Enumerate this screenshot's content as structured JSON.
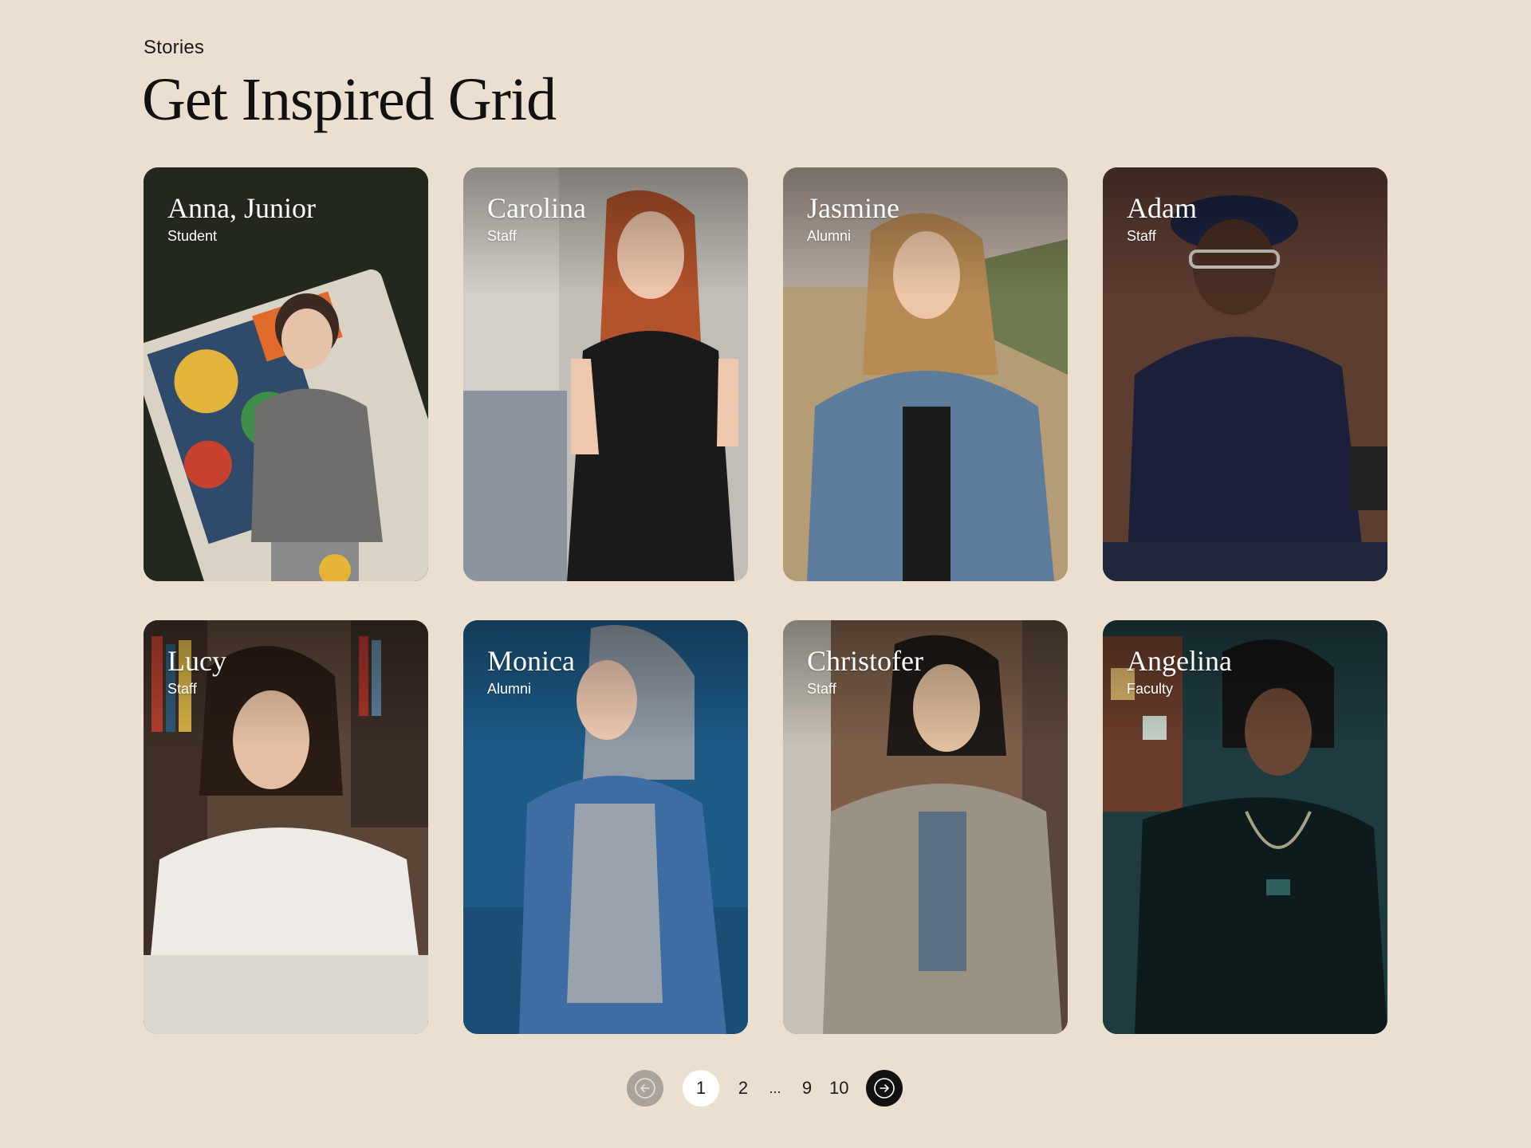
{
  "header": {
    "eyebrow": "Stories",
    "title": "Get Inspired Grid"
  },
  "cards": [
    {
      "name": "Anna, Junior",
      "role": "Student",
      "bg": "#22281e"
    },
    {
      "name": "Carolina",
      "role": "Staff",
      "bg": "#b9b3ac"
    },
    {
      "name": "Jasmine",
      "role": "Alumni",
      "bg": "#b9a688"
    },
    {
      "name": "Adam",
      "role": "Staff",
      "bg": "#5c3b2f"
    },
    {
      "name": "Lucy",
      "role": "Staff",
      "bg": "#6a5040"
    },
    {
      "name": "Monica",
      "role": "Alumni",
      "bg": "#1f5a85"
    },
    {
      "name": "Christofer",
      "role": "Staff",
      "bg": "#6b5444"
    },
    {
      "name": "Angelina",
      "role": "Faculty",
      "bg": "#1f3d41"
    }
  ],
  "pagination": {
    "prev_icon": "arrow-left-icon",
    "next_icon": "arrow-right-icon",
    "pages": [
      "1",
      "2",
      "...",
      "9",
      "10"
    ],
    "current": "1"
  }
}
